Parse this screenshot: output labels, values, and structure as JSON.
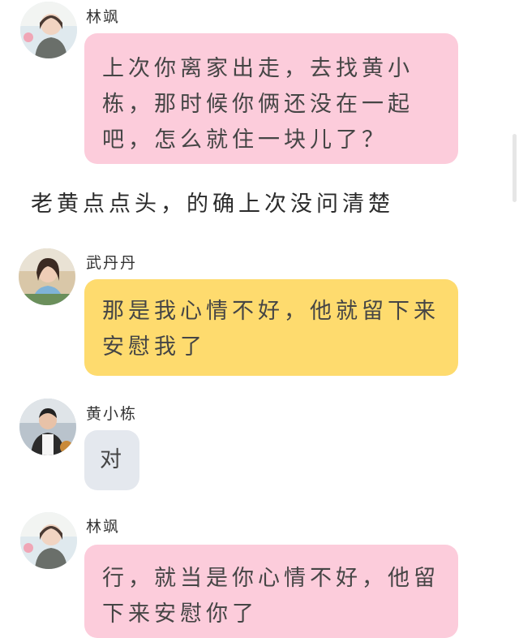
{
  "messages": [
    {
      "speaker": "林飒",
      "text": "上次你离家出走，去找黄小栋，那时候你俩还没在一起吧，怎么就住一块儿了？",
      "bubble_color": "#fcccdb"
    },
    {
      "speaker": "武丹丹",
      "text": "那是我心情不好，他就留下来安慰我了",
      "bubble_color": "#fedb6e"
    },
    {
      "speaker": "黄小栋",
      "text": "对",
      "bubble_color": "#e4e8ee"
    },
    {
      "speaker": "林飒",
      "text": "行，就当是你心情不好，他留下来安慰你了",
      "bubble_color": "#fcccdb"
    }
  ],
  "narration": "老黄点点头，的确上次没问清楚",
  "icons": {
    "avatar_1": "woman-avatar-icon",
    "avatar_2": "woman-avatar-icon",
    "avatar_3": "man-avatar-icon",
    "avatar_4": "woman-avatar-icon"
  }
}
